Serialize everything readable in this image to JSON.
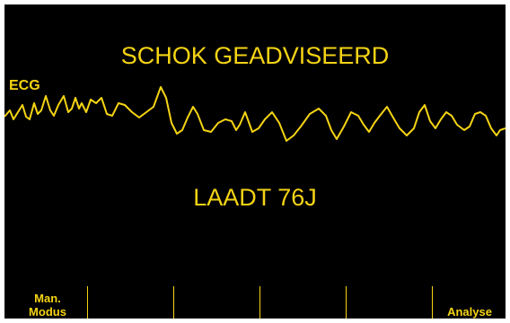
{
  "monitor": {
    "shock_advisory": "SCHOK GEADVISEERD",
    "ecg_lead_label": "ECG",
    "charge_status": "LAADT 76J",
    "waveform_color": "#f5d414",
    "background_color": "#000000"
  },
  "softkeys": {
    "left_label_line1": "Man.",
    "left_label_line2": "Modus",
    "right_label": "Analyse"
  }
}
